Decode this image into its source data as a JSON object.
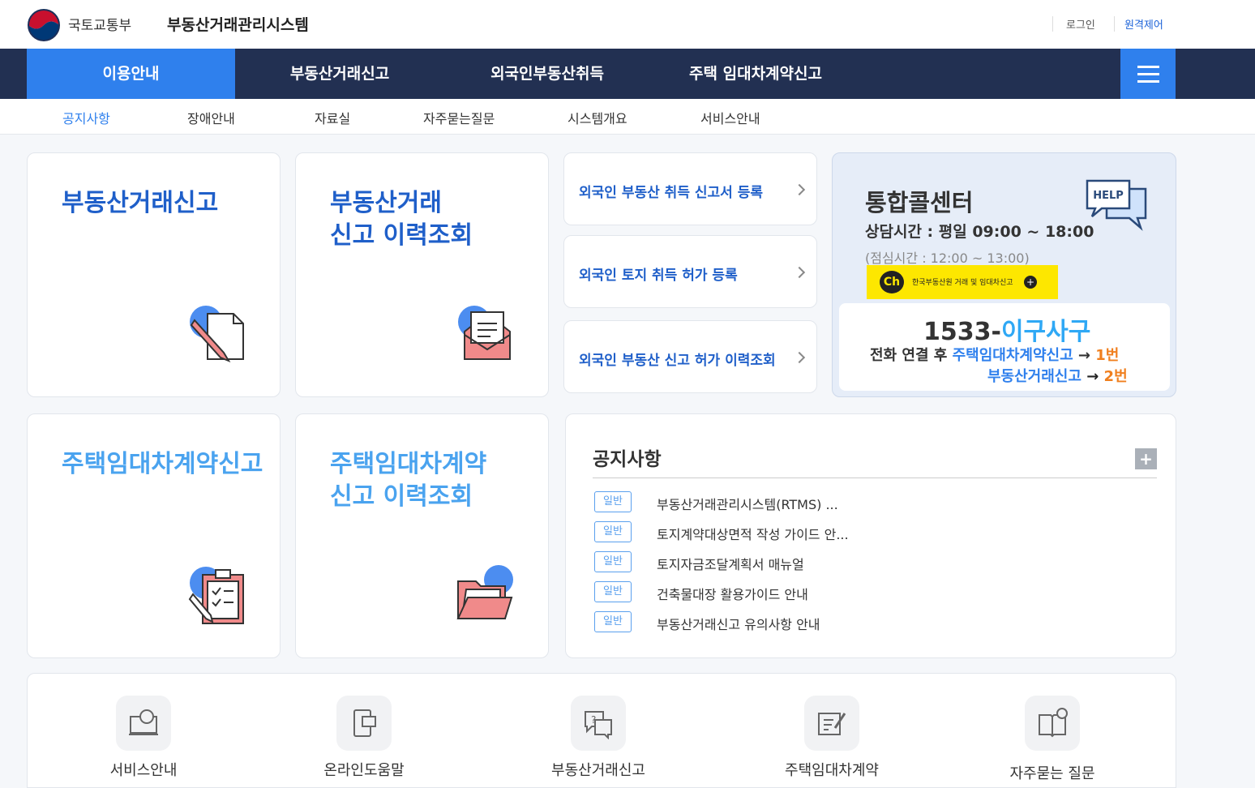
{
  "header": {
    "ministry": "국토교통부",
    "system_name": "부동산거래관리시스템",
    "login": "로그인",
    "remote": "원격제어"
  },
  "gnb": [
    "이용안내",
    "부동산거래신고",
    "외국인부동산취득",
    "주택 임대차계약신고"
  ],
  "lnb": [
    "공지사항",
    "장애안내",
    "자료실",
    "자주묻는질문",
    "시스템개요",
    "서비스안내"
  ],
  "cards": {
    "c1_l1": "부동산거래신고",
    "c2_l1": "부동산거래",
    "c2_l2": "신고 이력조회",
    "c3_l1": "주택임대차계약신고",
    "c4_l1": "주택임대차계약",
    "c4_l2": "신고 이력조회"
  },
  "links": [
    "외국인 부동산 취득 신고서 등록",
    "외국인 토지 취득 허가 등록",
    "외국인 부동산 신고 허가 이력조회"
  ],
  "call_center": {
    "title": "통합콜센터",
    "hours": "상담시간 : 평일 09:00 ~ 18:00",
    "lunch": "(점심시간 : 12:00 ~ 13:00)",
    "kakao_badge": "Ch",
    "kakao_text": "한국부동산원 거래 및 임대차신고",
    "help": "HELP",
    "num_prefix": "1533-",
    "num_suffix": "이구사구",
    "line1_a": "전화 연결 후 ",
    "line1_b": "주택임대차계약신고",
    "line1_c": " → ",
    "line1_d": "1번",
    "line2_b": "부동산거래신고",
    "line2_c": " → ",
    "line2_d": "2번"
  },
  "notice": {
    "title": "공지사항",
    "more": "+",
    "badge": "일반",
    "items": [
      "부동산거래관리시스템(RTMS) ...",
      "토지계약대상면적 작성 가이드 안...",
      "토지자금조달계획서 매뉴얼",
      "건축물대장 활용가이드 안내",
      "부동산거래신고 유의사항 안내"
    ]
  },
  "quick": [
    "서비스안내",
    "온라인도움말",
    "부동산거래신고",
    "주택임대차계약",
    "자주묻는 질문"
  ],
  "colors": {
    "nav": "#223052",
    "accent": "#2f80ed",
    "title_blue": "#1f5fc9",
    "title_sky": "#4aa3ef",
    "orange": "#f07f1e",
    "kakao": "#fde700"
  }
}
